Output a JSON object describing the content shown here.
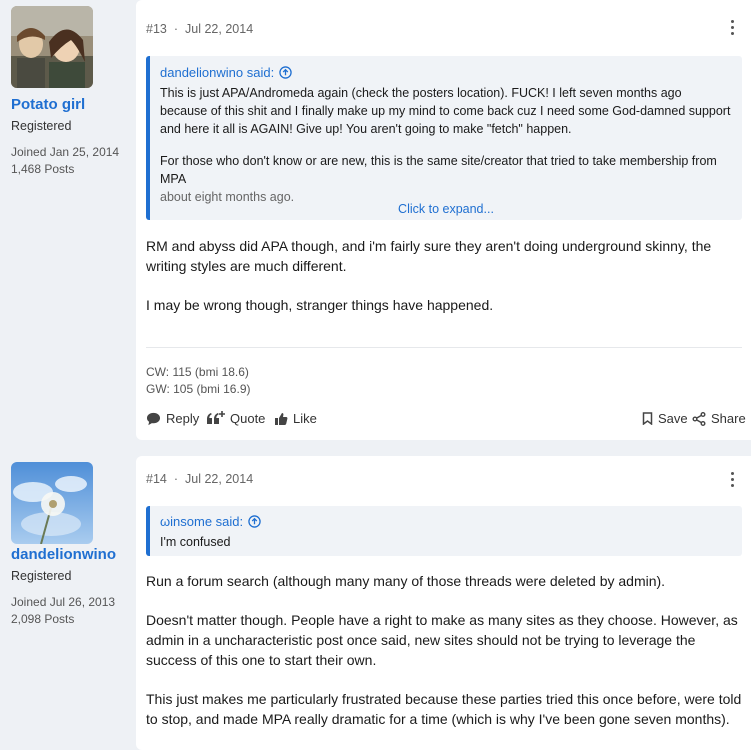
{
  "posts": [
    {
      "user": {
        "name": "Potato girl",
        "title": "Registered",
        "joined": "Joined Jan 25, 2014",
        "posts": "1,468 Posts"
      },
      "number": "#13",
      "date": "Jul 22, 2014",
      "quote": {
        "author": "dandelionwino said:",
        "paragraphs": [
          "This is just APA/Andromeda again (check the posters location). FUCK! I left seven months ago because of this shit and I finally make up my mind to come back cuz I need some God-damned support and here it all is AGAIN! Give up! You aren't going to make \"fetch\" happen.",
          "For those who don't know or are new, this is the same site/creator that tried to take membership from MPA"
        ],
        "faded": "about eight months ago.",
        "expand": "Click to expand..."
      },
      "message": [
        "RM and abyss did APA though, and i'm fairly sure they aren't doing underground skinny, the writing styles are much different.",
        "I may be wrong though, stranger things have happened."
      ],
      "signature": [
        "CW: 115 (bmi 18.6)",
        "GW: 105 (bmi 16.9)"
      ],
      "actions": {
        "reply": "Reply",
        "quote": "Quote",
        "like": "Like",
        "save": "Save",
        "share": "Share"
      }
    },
    {
      "user": {
        "name": "dandelionwino",
        "title": "Registered",
        "joined": "Joined Jul 26, 2013",
        "posts": "2,098 Posts"
      },
      "number": "#14",
      "date": "Jul 22, 2014",
      "quote": {
        "author": "ωinsome said:",
        "paragraphs": [
          "I'm confused"
        ]
      },
      "message": [
        "Run a forum search (although many many of those threads were deleted by admin).",
        "Doesn't matter though. People have a right to make as many sites as they choose. However, as admin in a uncharacteristic post once said, new sites should not be trying to leverage the success of this one to start their own.",
        "This just makes me particularly frustrated because these parties tried this once before, were told to stop, and made MPA really dramatic for a time (which is why I've been gone seven months)."
      ]
    }
  ],
  "colors": {
    "link": "#1f6fd1",
    "background": "#eef1f5",
    "card": "#ffffff"
  }
}
